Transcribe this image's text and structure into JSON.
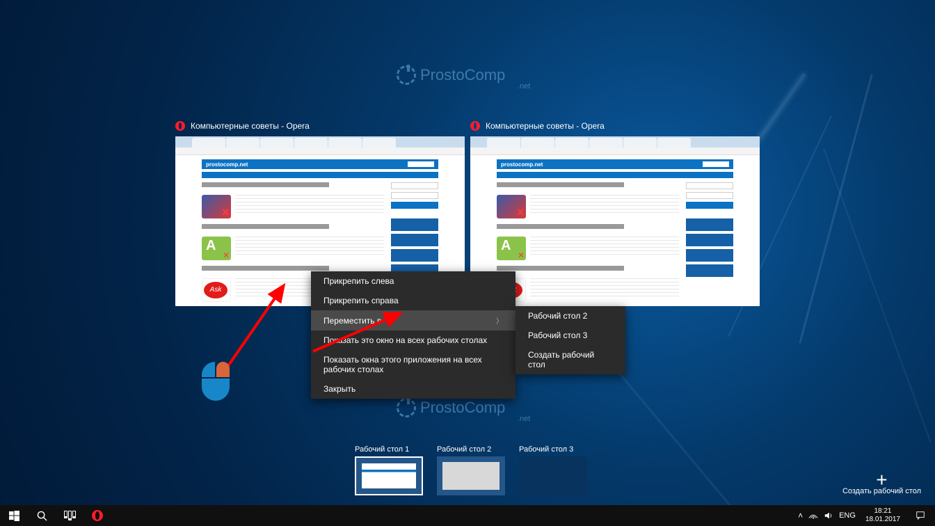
{
  "watermark": {
    "name": "ProstoComp",
    "sub": ".net"
  },
  "thumbs": [
    {
      "title": "Компьютерные советы - Opera",
      "site": "prostocomp.net"
    },
    {
      "title": "Компьютерные советы - Opera",
      "site": "prostocomp.net"
    }
  ],
  "context_menu": {
    "snap_left": "Прикрепить слева",
    "snap_right": "Прикрепить справа",
    "move_to": "Переместить в",
    "show_all": "Показать это окно на всех рабочих столах",
    "show_app_all": "Показать окна этого приложения на всех рабочих столах",
    "close": "Закрыть"
  },
  "submenu": {
    "d2": "Рабочий стол 2",
    "d3": "Рабочий стол 3",
    "new": "Создать рабочий стол"
  },
  "desktops": [
    {
      "label": "Рабочий стол 1"
    },
    {
      "label": "Рабочий стол 2"
    },
    {
      "label": "Рабочий стол 3"
    }
  ],
  "new_desktop": {
    "label": "Создать рабочий стол"
  },
  "tray": {
    "lang": "ENG",
    "time": "18:21",
    "date": "18.01.2017"
  }
}
